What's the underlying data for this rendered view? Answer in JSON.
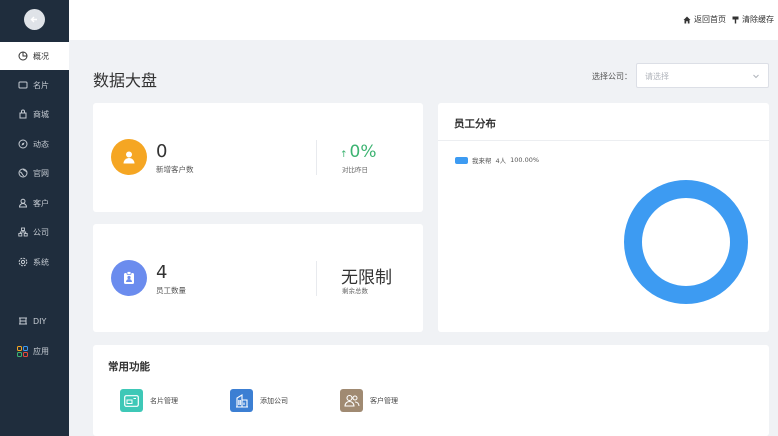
{
  "sidebar": {
    "items": [
      {
        "label": "概况",
        "icon": "dashboard-icon",
        "active": true
      },
      {
        "label": "名片",
        "icon": "card-icon"
      },
      {
        "label": "商城",
        "icon": "shop-icon"
      },
      {
        "label": "动态",
        "icon": "compass-icon"
      },
      {
        "label": "官网",
        "icon": "globe-icon"
      },
      {
        "label": "客户",
        "icon": "user-icon"
      },
      {
        "label": "公司",
        "icon": "org-icon"
      },
      {
        "label": "系统",
        "icon": "gear-icon"
      },
      {
        "label": "DIY",
        "icon": "diy-icon"
      },
      {
        "label": "应用",
        "icon": "apps-icon"
      }
    ]
  },
  "header": {
    "home_link": "返回首页",
    "clear_cache": "清除缓存"
  },
  "main": {
    "title": "数据大盘",
    "company_select": {
      "label": "选择公司：",
      "placeholder": "请选择"
    }
  },
  "stats": {
    "new_customers": {
      "value": "0",
      "label": "新增客户数",
      "change": "0%",
      "change_arrow": "↑",
      "change_label": "对比昨日"
    },
    "employees": {
      "value": "4",
      "label": "员工数量",
      "remaining": "无限制",
      "remaining_label": "剩余总数"
    }
  },
  "distribution": {
    "title": "员工分布",
    "legend": [
      {
        "name": "我来帮",
        "count": "4人",
        "percent": "100.00%",
        "color": "#3d9bf2"
      }
    ],
    "chart": {
      "type": "donut",
      "values": [
        100
      ]
    }
  },
  "common": {
    "title": "常用功能",
    "items": [
      {
        "label": "名片管理",
        "color": "#3ec8b7"
      },
      {
        "label": "添加公司",
        "color": "#3c7fd3"
      },
      {
        "label": "客户管理",
        "color": "#a08a72"
      }
    ]
  },
  "colors": {
    "sidebar_bg": "#1f2d3d",
    "accent_blue": "#3d9bf2",
    "green": "#3cb371",
    "orange": "#f5a623",
    "purple_blue": "#6b8cee"
  }
}
